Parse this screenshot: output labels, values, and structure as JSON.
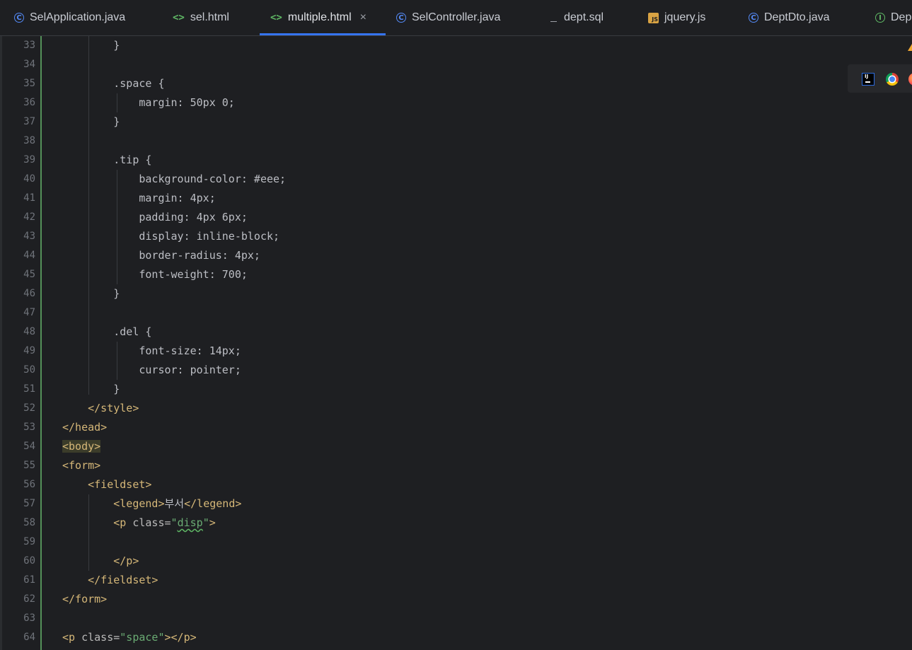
{
  "tabs": [
    {
      "label": "SelApplication.java",
      "icon": "java-class-icon",
      "active": false
    },
    {
      "label": "sel.html",
      "icon": "html-file-icon",
      "active": false
    },
    {
      "label": "multiple.html",
      "icon": "html-file-icon",
      "active": true,
      "close": "×"
    },
    {
      "label": "SelController.java",
      "icon": "java-class-icon",
      "active": false
    },
    {
      "label": "dept.sql",
      "icon": "sql-file-icon",
      "active": false
    },
    {
      "label": "jquery.js",
      "icon": "js-file-icon",
      "active": false
    },
    {
      "label": "DeptDto.java",
      "icon": "java-class-icon",
      "active": false
    },
    {
      "label": "Dep",
      "icon": "java-interface-icon",
      "active": false
    }
  ],
  "icon_glyphs": {
    "class": "C",
    "interface": "I",
    "html": "<>",
    "js": "JS"
  },
  "editor": {
    "line_numbers": [
      "33",
      "34",
      "35",
      "36",
      "37",
      "38",
      "39",
      "40",
      "41",
      "42",
      "43",
      "44",
      "45",
      "46",
      "47",
      "48",
      "49",
      "50",
      "51",
      "52",
      "53",
      "54",
      "55",
      "56",
      "57",
      "58",
      "59",
      "60",
      "61",
      "62",
      "63",
      "64"
    ],
    "lines": {
      "l33": "}",
      "l35_sel": ".space {",
      "l36": "margin: 50px 0;",
      "l37": "}",
      "l39_sel": ".tip {",
      "l40": "background-color: #eee;",
      "l41": "margin: 4px;",
      "l42": "padding: 4px 6px;",
      "l43": "display: inline-block;",
      "l44": "border-radius: 4px;",
      "l45": "font-weight: 700;",
      "l46": "}",
      "l48_sel": ".del {",
      "l49": "font-size: 14px;",
      "l50": "cursor: pointer;",
      "l51": "}",
      "l52": "</style>",
      "l53": "</head>",
      "l54": "<body>",
      "l55": "<form>",
      "l56": "<fieldset>",
      "l57_open": "<legend>",
      "l57_text": "부서",
      "l57_close": "</legend>",
      "l58_open": "<p ",
      "l58_attr": "class=",
      "l58_q1": "\"",
      "l58_val": "disp",
      "l58_q2": "\"",
      "l58_end": ">",
      "l60": "</p>",
      "l61": "</fieldset>",
      "l62": "</form>",
      "l64_open": "<p ",
      "l64_attr": "class=",
      "l64_str": "\"space\"",
      "l64_end": "></p>"
    }
  },
  "colors": {
    "background": "#1e1f22",
    "tag": "#d5b778",
    "string": "#6aab73",
    "text": "#bcbec4",
    "line_number": "#6f737a",
    "active_tab_underline": "#3574f0",
    "vcs_added": "#549159"
  },
  "browser_popup": {
    "icons": [
      "intellij-icon",
      "chrome-icon",
      "firefox-icon"
    ]
  }
}
